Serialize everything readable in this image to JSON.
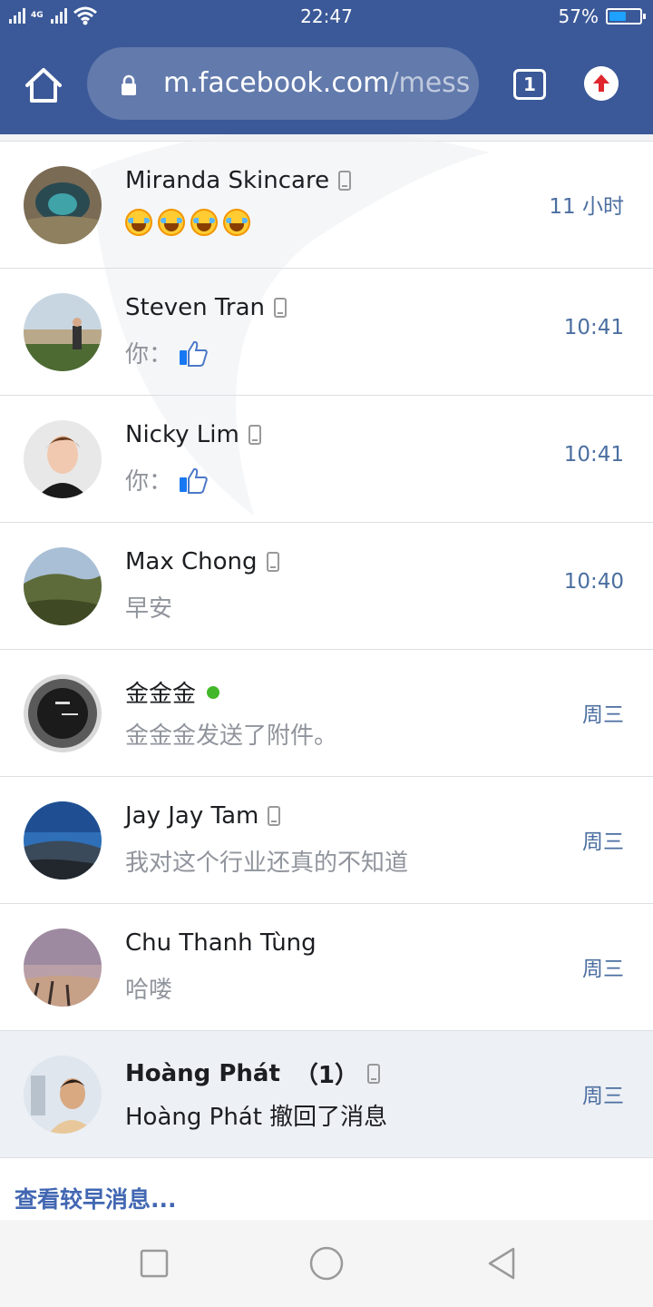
{
  "status_bar": {
    "time": "22:47",
    "battery_percent_label": "57%",
    "battery_level": 0.57,
    "network_label": "4G"
  },
  "browser": {
    "url_host": "m.facebook.com",
    "url_path": "/mess",
    "tab_count": "1"
  },
  "threads": [
    {
      "name": "Miranda Skincare",
      "snippet_emoji_count": 4,
      "time": "11 小时",
      "mobile": true,
      "online": false,
      "unread": false
    },
    {
      "name": "Steven Tran",
      "snippet": "你：",
      "snippet_like": true,
      "time": "10:41",
      "mobile": true,
      "online": false,
      "unread": false
    },
    {
      "name": "Nicky Lim",
      "snippet": "你：",
      "snippet_like": true,
      "time": "10:41",
      "mobile": true,
      "online": false,
      "unread": false
    },
    {
      "name": "Max Chong",
      "snippet": "早安",
      "time": "10:40",
      "mobile": true,
      "online": false,
      "unread": false
    },
    {
      "name": "金金金",
      "snippet": "金金金发送了附件。",
      "time": "周三",
      "mobile": false,
      "online": true,
      "unread": false
    },
    {
      "name": "Jay Jay Tam",
      "snippet": "我对这个行业还真的不知道",
      "time": "周三",
      "mobile": true,
      "online": false,
      "unread": false
    },
    {
      "name": "Chu Thanh Tùng",
      "snippet": "哈喽",
      "time": "周三",
      "mobile": false,
      "online": false,
      "unread": false
    },
    {
      "name": "Hoàng Phát",
      "unread_count": "（1）",
      "snippet": "Hoàng Phát 撤回了消息",
      "time": "周三",
      "mobile": true,
      "online": false,
      "unread": true
    }
  ],
  "see_older_label": "查看较早消息...",
  "colors": {
    "brand": "#3b5998",
    "online": "#42b72a",
    "timestamp": "#4b6ea0",
    "unread_row": "#edf0f5"
  },
  "icons": {
    "home": "home-icon",
    "lock": "lock-icon",
    "tabs": "tab-switcher-icon",
    "upload": "upload-icon",
    "nav": [
      "recent-apps-icon",
      "home-circle-icon",
      "back-triangle-icon"
    ]
  }
}
